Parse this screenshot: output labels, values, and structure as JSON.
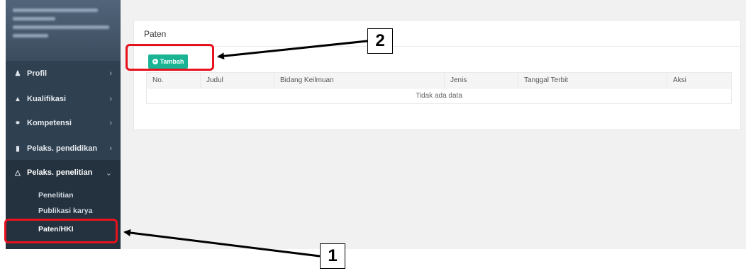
{
  "sidebar": {
    "items": [
      {
        "label": "Profil",
        "icon": "user-icon"
      },
      {
        "label": "Kualifikasi",
        "icon": "graduation-cap-icon"
      },
      {
        "label": "Kompetensi",
        "icon": "handshake-icon"
      },
      {
        "label": "Pelaks. pendidikan",
        "icon": "book-icon"
      },
      {
        "label": "Pelaks. penelitian",
        "icon": "flask-icon"
      }
    ],
    "submenu": [
      "Penelitian",
      "Publikasi karya",
      "Paten/HKI"
    ]
  },
  "card": {
    "title": "Paten",
    "add_label": "Tambah"
  },
  "table": {
    "columns": [
      "No.",
      "Judul",
      "Bidang Keilmuan",
      "Jenis",
      "Tanggal Terbit",
      "Aksi"
    ],
    "empty_text": "Tidak ada data"
  },
  "annotations": {
    "callout_1": "1",
    "callout_2": "2"
  },
  "colors": {
    "sidebar": "#2f4050",
    "accent": "#1ab394",
    "highlight": "#e8121d"
  }
}
